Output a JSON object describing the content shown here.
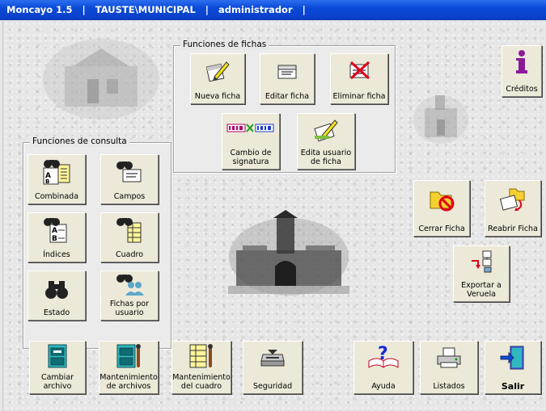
{
  "window": {
    "title": "Moncayo 1.5   |   TAUSTE\\MUNICIPAL   |   administrador   |"
  },
  "fichas": {
    "title": "Funciones de fichas",
    "nueva": "Nueva ficha",
    "editar": "Editar ficha",
    "eliminar": "Eliminar ficha",
    "cambio_1": "Cambio de",
    "cambio_2": "signatura",
    "edita_1": "Edita usuario",
    "edita_2": "de ficha"
  },
  "consulta": {
    "title": "Funciones de consulta",
    "combinada": "Combinada",
    "campos": "Campos",
    "indices": "Índices",
    "cuadro": "Cuadro",
    "estado": "Estado",
    "fichas_usuario_1": "Fichas por",
    "fichas_usuario_2": "usuario"
  },
  "side": {
    "creditos": "Créditos",
    "cerrar": "Cerrar Ficha",
    "reabrir": "Reabrir Ficha",
    "exportar_1": "Exportar a",
    "exportar_2": "Veruela"
  },
  "bottom": {
    "cambiar_1": "Cambiar",
    "cambiar_2": "archivo",
    "mant_arch_1": "Mantenimiento",
    "mant_arch_2": "de archivos",
    "mant_cuad_1": "Mantenimiento",
    "mant_cuad_2": "del cuadro",
    "seguridad": "Seguridad",
    "ayuda": "Ayuda",
    "listados": "Listados",
    "salir": "Salir"
  },
  "colors": {
    "titlebar": "#0a4ad8",
    "button_face": "#ece9d8",
    "accent_red": "#e0001b"
  }
}
